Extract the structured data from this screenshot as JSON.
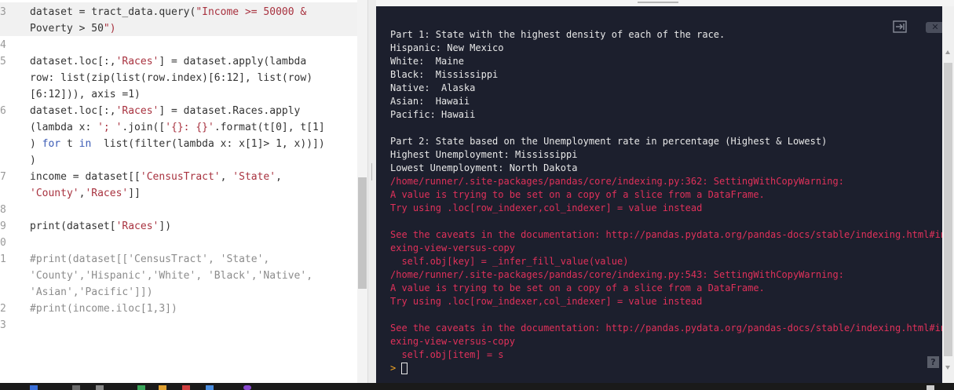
{
  "editor": {
    "line_numbers": [
      "3",
      "4",
      "5",
      "6",
      "7",
      "8",
      "9",
      "0",
      "1",
      "2",
      "3"
    ],
    "lines": [
      "dataset = tract_data.query(\"Income >= 50000 &",
      "Poverty > 50\")",
      "dataset.loc[:,'Races'] = dataset.apply(lambda",
      "row: list(zip(list(row.index)[6:12], list(row)",
      "[6:12])), axis =1)",
      "dataset.loc[:,'Races'] = dataset.Races.apply",
      "(lambda x: '; '.join(['{}: {}'.format(t[0], t[1]",
      ") for t in  list(filter(lambda x: x[1]> 1, x))])",
      ")",
      "income = dataset[['CensusTract', 'State',",
      "'County','Races']]",
      "print(dataset['Races'])",
      "#print(dataset[['CensusTract', 'State',",
      "'County','Hispanic','White', 'Black','Native',",
      "'Asian','Pacific']])",
      "#print(income.iloc[1,3])"
    ]
  },
  "console": {
    "output": [
      {
        "text": "Part 1: State with the highest density of each of the race.",
        "kind": "out"
      },
      {
        "text": "Hispanic: New Mexico",
        "kind": "out"
      },
      {
        "text": "White:  Maine",
        "kind": "out"
      },
      {
        "text": "Black:  Mississippi",
        "kind": "out"
      },
      {
        "text": "Native:  Alaska",
        "kind": "out"
      },
      {
        "text": "Asian:  Hawaii",
        "kind": "out"
      },
      {
        "text": "Pacific: Hawaii",
        "kind": "out"
      },
      {
        "text": "",
        "kind": "out"
      },
      {
        "text": "Part 2: State based on the Unemployment rate in percentage (Highest & Lowest)",
        "kind": "out"
      },
      {
        "text": "Highest Unemployment: Mississippi",
        "kind": "out"
      },
      {
        "text": "Lowest Unemployment: North Dakota",
        "kind": "out"
      },
      {
        "text": "/home/runner/.site-packages/pandas/core/indexing.py:362: SettingWithCopyWarning:",
        "kind": "err"
      },
      {
        "text": "A value is trying to be set on a copy of a slice from a DataFrame.",
        "kind": "err"
      },
      {
        "text": "Try using .loc[row_indexer,col_indexer] = value instead",
        "kind": "err"
      },
      {
        "text": "",
        "kind": "err"
      },
      {
        "text": "See the caveats in the documentation: http://pandas.pydata.org/pandas-docs/stable/indexing.html#ind",
        "kind": "err"
      },
      {
        "text": "exing-view-versus-copy",
        "kind": "err"
      },
      {
        "text": "  self.obj[key] = _infer_fill_value(value)",
        "kind": "err"
      },
      {
        "text": "/home/runner/.site-packages/pandas/core/indexing.py:543: SettingWithCopyWarning:",
        "kind": "err"
      },
      {
        "text": "A value is trying to be set on a copy of a slice from a DataFrame.",
        "kind": "err"
      },
      {
        "text": "Try using .loc[row_indexer,col_indexer] = value instead",
        "kind": "err"
      },
      {
        "text": "",
        "kind": "err"
      },
      {
        "text": "See the caveats in the documentation: http://pandas.pydata.org/pandas-docs/stable/indexing.html#ind",
        "kind": "err"
      },
      {
        "text": "exing-view-versus-copy",
        "kind": "err"
      },
      {
        "text": "  self.obj[item] = s",
        "kind": "err"
      }
    ],
    "prompt_symbol": ">",
    "buttons": {
      "embed_icon": "embed-icon",
      "clear_icon": "clear-icon",
      "help_label": "?"
    }
  },
  "colors": {
    "console_bg": "#1c1f2d",
    "console_text": "#e8e8e8",
    "console_error": "#e0315a",
    "prompt": "#f5a623",
    "string": "#a8323f",
    "keyword": "#3b5bb5",
    "comment": "#8c8c8c"
  }
}
